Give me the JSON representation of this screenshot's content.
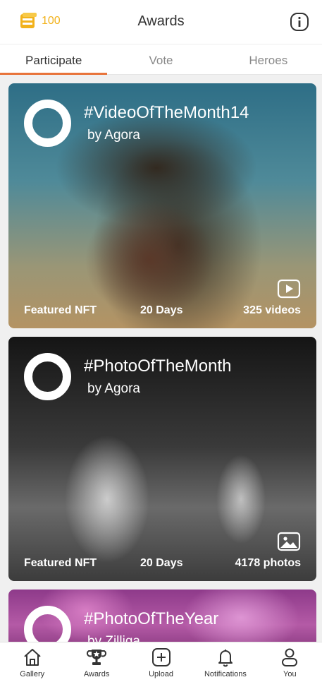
{
  "header": {
    "coin_count": "100",
    "title": "Awards",
    "coin_icon": "coins-icon",
    "info_icon": "info-icon"
  },
  "tabs": [
    {
      "label": "Participate",
      "active": true
    },
    {
      "label": "Vote",
      "active": false
    },
    {
      "label": "Heroes",
      "active": false
    }
  ],
  "cards": [
    {
      "title": "#VideoOfTheMonth14",
      "by": "by Agora",
      "tag": "Featured NFT",
      "duration": "20 Days",
      "count": "325 videos",
      "media_icon": "video-icon"
    },
    {
      "title": "#PhotoOfTheMonth",
      "by": "by Agora",
      "tag": "Featured NFT",
      "duration": "20 Days",
      "count": "4178 photos",
      "media_icon": "photo-icon"
    },
    {
      "title": "#PhotoOfTheYear",
      "by": "by Zilliqa"
    }
  ],
  "nav": [
    {
      "label": "Gallery",
      "icon": "home-icon"
    },
    {
      "label": "Awards",
      "icon": "trophy-icon"
    },
    {
      "label": "Upload",
      "icon": "upload-icon"
    },
    {
      "label": "Notifications",
      "icon": "bell-icon"
    },
    {
      "label": "You",
      "icon": "user-icon"
    }
  ],
  "colors": {
    "accent": "#e8743b",
    "coin": "#f2b21b"
  }
}
